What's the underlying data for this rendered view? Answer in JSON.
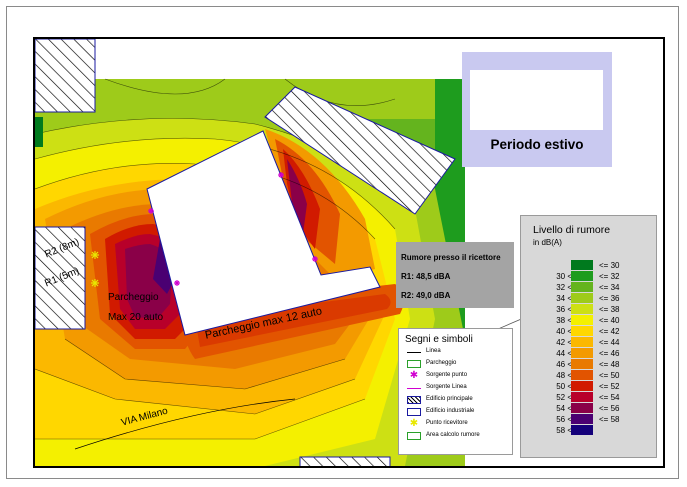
{
  "title": "Periodo estivo",
  "ricettore": {
    "heading": "Rumore presso il ricettore",
    "r1": "R1: 48,5 dBA",
    "r2": "R2: 49,0 dBA"
  },
  "map_labels": {
    "r2": "R2 (8m)",
    "r1": "R1 (5m)",
    "parcheggio_a1": "Parcheggio",
    "parcheggio_a2": "Max 20 auto",
    "parcheggio_b": "Parcheggio max 12 auto",
    "via": "VIA Milano"
  },
  "segni_simboli": {
    "title": "Segni e simboli",
    "items": [
      {
        "label": "Linea",
        "icon": "line-icon"
      },
      {
        "label": "Parcheggio",
        "icon": "parking-icon"
      },
      {
        "label": "Sorgente punto",
        "icon": "point-source-icon"
      },
      {
        "label": "Sorgente Linea",
        "icon": "line-source-icon"
      },
      {
        "label": "Edificio principale",
        "icon": "main-building-icon"
      },
      {
        "label": "Edificio industriale",
        "icon": "industrial-building-icon"
      },
      {
        "label": "Punto ricevitore",
        "icon": "receiver-point-icon"
      },
      {
        "label": "Area calcolo rumore",
        "icon": "calc-area-icon"
      }
    ]
  },
  "livello": {
    "title": "Livello di rumore",
    "unit": "in dB(A)",
    "rows": [
      {
        "lo": "",
        "hi": "<= 30",
        "color": "#007a1e"
      },
      {
        "lo": "30 <",
        "hi": "<= 32",
        "color": "#1e9c1e"
      },
      {
        "lo": "32 <",
        "hi": "<= 34",
        "color": "#64b41e"
      },
      {
        "lo": "34 <",
        "hi": "<= 36",
        "color": "#9ecb1a"
      },
      {
        "lo": "36 <",
        "hi": "<= 38",
        "color": "#cde014"
      },
      {
        "lo": "38 <",
        "hi": "<= 40",
        "color": "#f4f000"
      },
      {
        "lo": "40 <",
        "hi": "<= 42",
        "color": "#ffd700"
      },
      {
        "lo": "42 <",
        "hi": "<= 44",
        "color": "#fbb800"
      },
      {
        "lo": "44 <",
        "hi": "<= 46",
        "color": "#f39a00"
      },
      {
        "lo": "46 <",
        "hi": "<= 48",
        "color": "#e97a00"
      },
      {
        "lo": "48 <",
        "hi": "<= 50",
        "color": "#e25400"
      },
      {
        "lo": "50 <",
        "hi": "<= 52",
        "color": "#d11a00"
      },
      {
        "lo": "52 <",
        "hi": "<= 54",
        "color": "#b8002a"
      },
      {
        "lo": "54 <",
        "hi": "<= 56",
        "color": "#8a0048"
      },
      {
        "lo": "56 <",
        "hi": "<= 58",
        "color": "#4a0072"
      },
      {
        "lo": "58 <",
        "hi": "",
        "color": "#14007a"
      }
    ]
  }
}
